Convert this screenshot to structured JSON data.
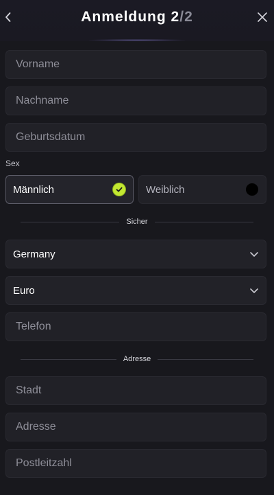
{
  "header": {
    "title_main": "Anmeldung 2",
    "title_sep": "/",
    "title_total": "2",
    "back_icon": "chevron-left-icon",
    "close_icon": "close-icon"
  },
  "form": {
    "first_name_placeholder": "Vorname",
    "last_name_placeholder": "Nachname",
    "birthdate_placeholder": "Geburtsdatum",
    "sex_label": "Sex",
    "sex_options": [
      {
        "label": "Männlich",
        "selected": true
      },
      {
        "label": "Weiblich",
        "selected": false
      }
    ],
    "security_divider": "Sicher",
    "country_value": "Germany",
    "currency_value": "Euro",
    "phone_placeholder": "Telefon",
    "address_divider": "Adresse",
    "city_placeholder": "Stadt",
    "address_placeholder": "Adresse",
    "postal_code_placeholder": "Postleitzahl"
  },
  "colors": {
    "background": "#18181d",
    "field": "#212127",
    "accent_selected": "#c3e831",
    "placeholder": "#8e8e98"
  }
}
